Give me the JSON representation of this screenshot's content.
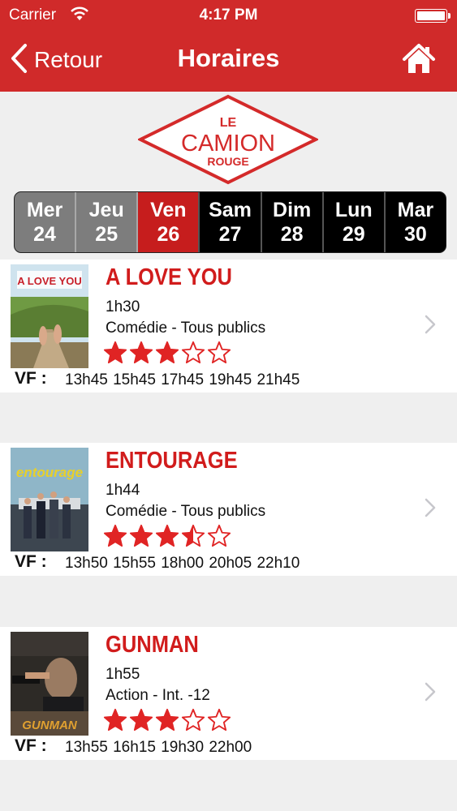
{
  "status": {
    "carrier": "Carrier",
    "time": "4:17 PM"
  },
  "nav": {
    "back_label": "Retour",
    "title": "Horaires"
  },
  "logo": {
    "line1": "LE",
    "line2": "CAMION",
    "line3": "ROUGE"
  },
  "days": [
    {
      "name": "Mer",
      "num": "24"
    },
    {
      "name": "Jeu",
      "num": "25"
    },
    {
      "name": "Ven",
      "num": "26"
    },
    {
      "name": "Sam",
      "num": "27"
    },
    {
      "name": "Dim",
      "num": "28"
    },
    {
      "name": "Lun",
      "num": "29"
    },
    {
      "name": "Mar",
      "num": "30"
    }
  ],
  "movies": [
    {
      "title": "A LOVE YOU",
      "duration": "1h30",
      "genre": "Comédie - Tous publics",
      "rating": 3,
      "version": "VF :",
      "times": "13h45 15h45 17h45 19h45 21h45",
      "poster_text": "A LOVE YOU"
    },
    {
      "title": "ENTOURAGE",
      "duration": "1h44",
      "genre": "Comédie - Tous publics",
      "rating": 3.5,
      "version": "VF :",
      "times": "13h50 15h55 18h00 20h05 22h10",
      "poster_text": "entourage"
    },
    {
      "title": "GUNMAN",
      "duration": "1h55",
      "genre": "Action - Int. -12",
      "rating": 3,
      "version": "VF :",
      "times": "13h55 16h15 19h30 22h00",
      "poster_text": "GUNMAN"
    }
  ],
  "colors": {
    "brand": "#d02a2a",
    "star": "#e02424",
    "selected_day": "#c61d1d"
  }
}
